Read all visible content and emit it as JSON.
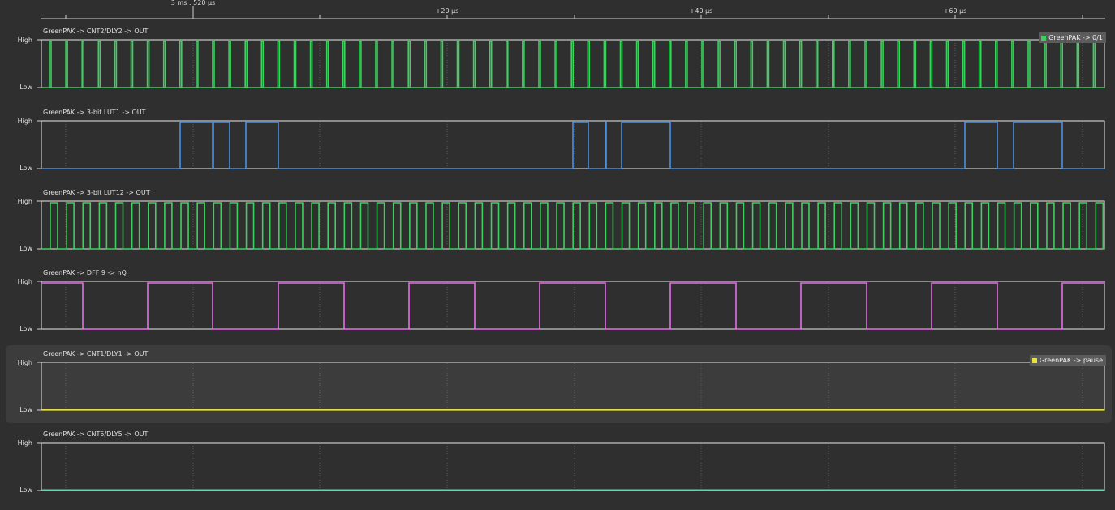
{
  "timeline": {
    "cursor_label": "3 ms : 520 µs",
    "tick_labels": [
      "+20 µs",
      "+40 µs",
      "+60 µs"
    ]
  },
  "panels": [
    {
      "title": "GreenPAK -> CNT2/DLY2 -> OUT",
      "high_label": "High",
      "low_label": "Low",
      "color": "#3ecf5e",
      "selected": false,
      "legend": {
        "label": "GreenPAK -> 0/1",
        "color": "#3ecf5e"
      }
    },
    {
      "title": "GreenPAK -> 3-bit LUT1 -> OUT",
      "high_label": "High",
      "low_label": "Low",
      "color": "#4a90e2",
      "selected": false,
      "legend": null
    },
    {
      "title": "GreenPAK -> 3-bit LUT12 -> OUT",
      "high_label": "High",
      "low_label": "Low",
      "color": "#3ecf5e",
      "selected": false,
      "legend": null
    },
    {
      "title": "GreenPAK -> DFF 9 -> nQ",
      "high_label": "High",
      "low_label": "Low",
      "color": "#e36ee8",
      "selected": false,
      "legend": null
    },
    {
      "title": "GreenPAK -> CNT1/DLY1 -> OUT",
      "high_label": "High",
      "low_label": "Low",
      "color": "#e8e23a",
      "selected": true,
      "legend": {
        "label": "GreenPAK -> pause",
        "color": "#e8e23a"
      }
    },
    {
      "title": "GreenPAK -> CNT5/DLY5 -> OUT",
      "high_label": "High",
      "low_label": "Low",
      "color": "#62d6b0",
      "selected": false,
      "legend": null
    }
  ]
}
